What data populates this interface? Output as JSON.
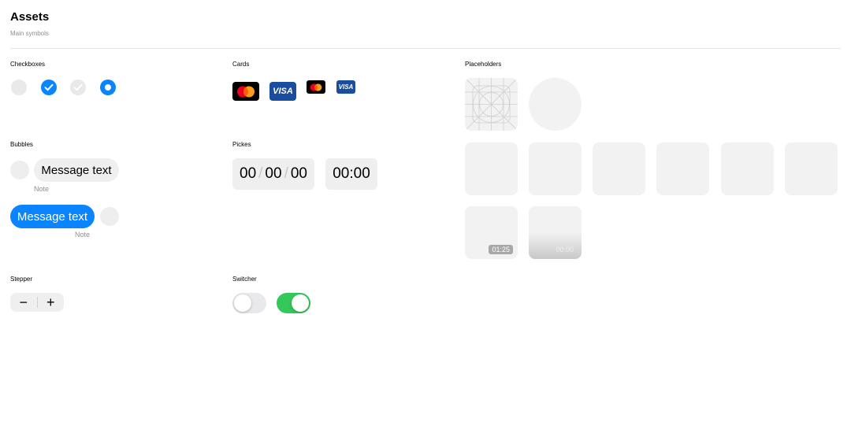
{
  "header": {
    "title": "Assets",
    "subtitle": "Main symbols"
  },
  "sections": {
    "checkboxes": "Checkboxes",
    "cards": "Cards",
    "placeholders": "Placeholders",
    "bubbles": "Bubbles",
    "pickers": "Pickes",
    "stepper": "Stepper",
    "switcher": "Switcher"
  },
  "cards": {
    "visa_label": "VISA"
  },
  "bubbles": {
    "incoming": {
      "text": "Message text",
      "note": "Note"
    },
    "outgoing": {
      "text": "Message text",
      "note": "Note"
    }
  },
  "pickers": {
    "date": {
      "day": "00",
      "month": "00",
      "year": "00",
      "separator": "/"
    },
    "time": {
      "value": "00:00"
    }
  },
  "placeholders": {
    "video_1_duration": "01:25",
    "video_2_duration": "00:00"
  },
  "stepper": {
    "minus": "−",
    "plus": "+"
  },
  "switcher": {
    "off_state": false,
    "on_state": true
  },
  "colors": {
    "accent": "#0a84ff",
    "switch_on": "#34c759",
    "placeholder": "#f2f2f2",
    "visa_blue": "#1a4d9e"
  }
}
